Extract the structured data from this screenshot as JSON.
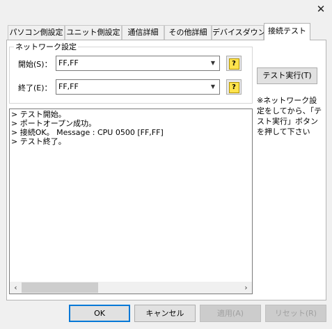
{
  "window": {
    "close_glyph": "✕"
  },
  "tabs": [
    {
      "label": "パソコン側設定"
    },
    {
      "label": "ユニット側設定"
    },
    {
      "label": "通信詳細"
    },
    {
      "label": "その他詳細"
    },
    {
      "label": "デバイスダウン"
    },
    {
      "label": "接続テスト",
      "active": true
    }
  ],
  "network": {
    "group_label": "ネットワーク設定",
    "start_label": "開始(S)：",
    "start_value": "FF,FF",
    "end_label": "終了(E)：",
    "end_value": "FF,FF",
    "help_glyph": "?"
  },
  "test_button_label": "テスト実行(T)",
  "note": "※ネットワーク設定をしてから、「テスト実行」ボタンを押して下さい",
  "log_lines": [
    "> テスト開始。",
    "> ポートオープン成功。",
    "> 接続OK。 Message : CPU 0500 [FF,FF]",
    "> テスト終了。"
  ],
  "scroll": {
    "left_arrow": "‹",
    "right_arrow": "›"
  },
  "buttons": {
    "ok": "OK",
    "cancel": "キャンセル",
    "apply": "適用(A)",
    "reset": "リセット(R)"
  }
}
